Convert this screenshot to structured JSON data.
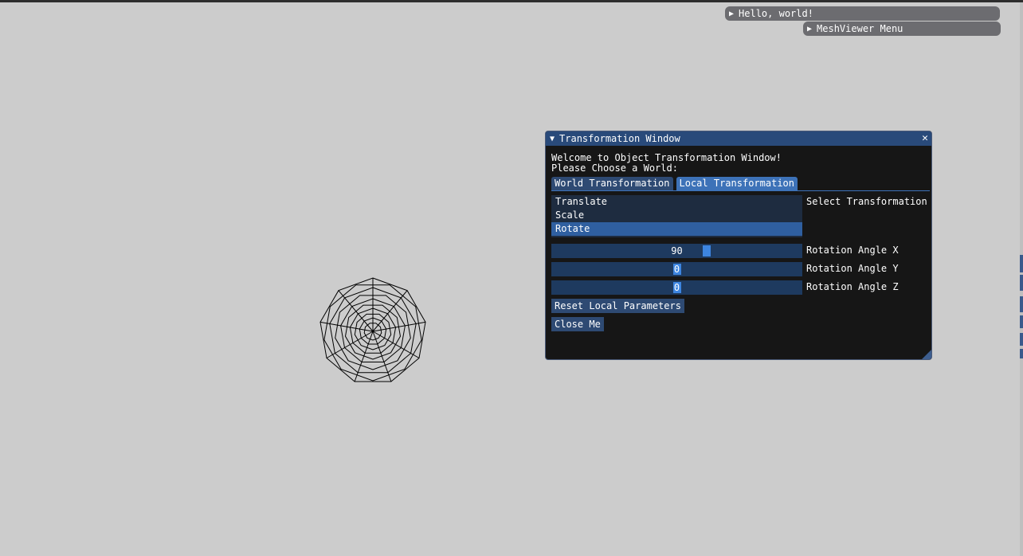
{
  "colors": {
    "background": "#cccccc",
    "window_bg": "#161616",
    "title_bar": "#294a7a",
    "accent": "#3d85e0",
    "frame_bg": "#1e3a5f"
  },
  "collapsed_windows": [
    {
      "label": "Hello, world!",
      "icon": "triangle-right-icon"
    },
    {
      "label": "MeshViewer Menu",
      "icon": "triangle-right-icon"
    }
  ],
  "transform_window": {
    "title": "Transformation Window",
    "collapse_icon": "triangle-down-icon",
    "close_icon": "close-icon",
    "welcome_text": "Welcome to Object Transformation Window!",
    "choose_text": "Please Choose a World:",
    "tabs": [
      {
        "label": "World Transformation",
        "active": false
      },
      {
        "label": "Local Transformation",
        "active": true
      }
    ],
    "listbox": {
      "items": [
        "Translate",
        "Scale",
        "Rotate"
      ],
      "selected": "Rotate",
      "label": "Select Transformation"
    },
    "sliders": [
      {
        "label": "Rotation Angle X",
        "value": "90",
        "fraction": 0.625
      },
      {
        "label": "Rotation Angle Y",
        "value": "0",
        "fraction": 0.5
      },
      {
        "label": "Rotation Angle Z",
        "value": "0",
        "fraction": 0.5
      }
    ],
    "buttons": {
      "reset": "Reset Local Parameters",
      "close": "Close Me"
    }
  }
}
